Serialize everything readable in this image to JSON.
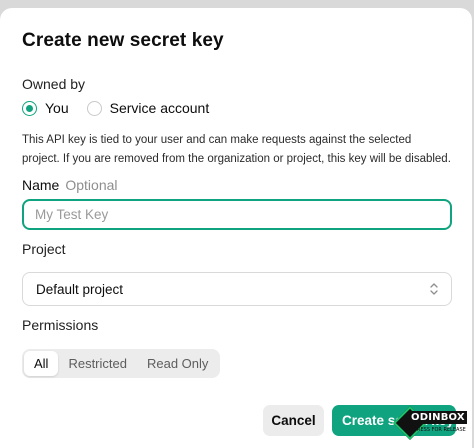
{
  "dialog": {
    "title": "Create new secret key"
  },
  "owned_by": {
    "label": "Owned by",
    "options": [
      {
        "label": "You",
        "selected": true
      },
      {
        "label": "Service account",
        "selected": false
      }
    ],
    "description": "This API key is tied to your user and can make requests against the selected project. If you are removed from the organization or project, this key will be disabled."
  },
  "name_field": {
    "label": "Name",
    "optional_label": "Optional",
    "placeholder": "My Test Key",
    "value": ""
  },
  "project": {
    "label": "Project",
    "selected": "Default project"
  },
  "permissions": {
    "label": "Permissions",
    "options": [
      "All",
      "Restricted",
      "Read Only"
    ],
    "selected": "All"
  },
  "actions": {
    "cancel_label": "Cancel",
    "create_label": "Create secret key"
  },
  "watermark": {
    "text": "ODINBOX",
    "subtext": "PRESS FOR RELEASE"
  },
  "colors": {
    "accent": "#10a37f",
    "overlay": "#d9d9d9",
    "segment_bg": "#ececec"
  }
}
